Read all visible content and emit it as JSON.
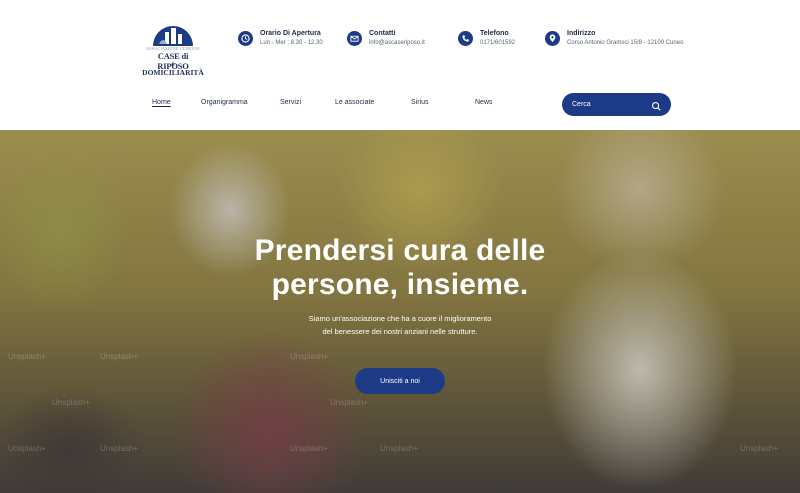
{
  "logo": {
    "line1": "ASSOCIAZIONE CUNEESE",
    "line2": "CASE di RIPOSO",
    "line3": "e DOMICILIARITÀ"
  },
  "info": [
    {
      "title": "Orario Di Apertura",
      "value": "Lun - Mer : 8.30 - 12.30",
      "icon": "clock-icon"
    },
    {
      "title": "Contatti",
      "value": "info@ascaseriposo.it",
      "icon": "mail-icon"
    },
    {
      "title": "Telefono",
      "value": "0171/601592",
      "icon": "phone-icon"
    },
    {
      "title": "Indirizzo",
      "value": "Corso Antonio Gramsci 15/8 - 12100 Cuneo",
      "icon": "map-pin-icon"
    }
  ],
  "nav": {
    "items": [
      "Home",
      "Organigramma",
      "Servizi",
      "Le associate",
      "Sirius",
      "News"
    ],
    "active": "Home"
  },
  "search": {
    "placeholder": "Cerca"
  },
  "hero": {
    "title_line1": "Prendersi cura delle",
    "title_line2": "persone, insieme.",
    "subtitle_line1": "Siamo un'associazione che ha a cuore il miglioramento",
    "subtitle_line2": "del benessere dei nostri anziani nelle strutture.",
    "cta": "Unisciti a noi",
    "watermark": "Unsplash+"
  },
  "colors": {
    "brand": "#1d3a86",
    "text": "#1d2a4d",
    "white": "#ffffff"
  }
}
